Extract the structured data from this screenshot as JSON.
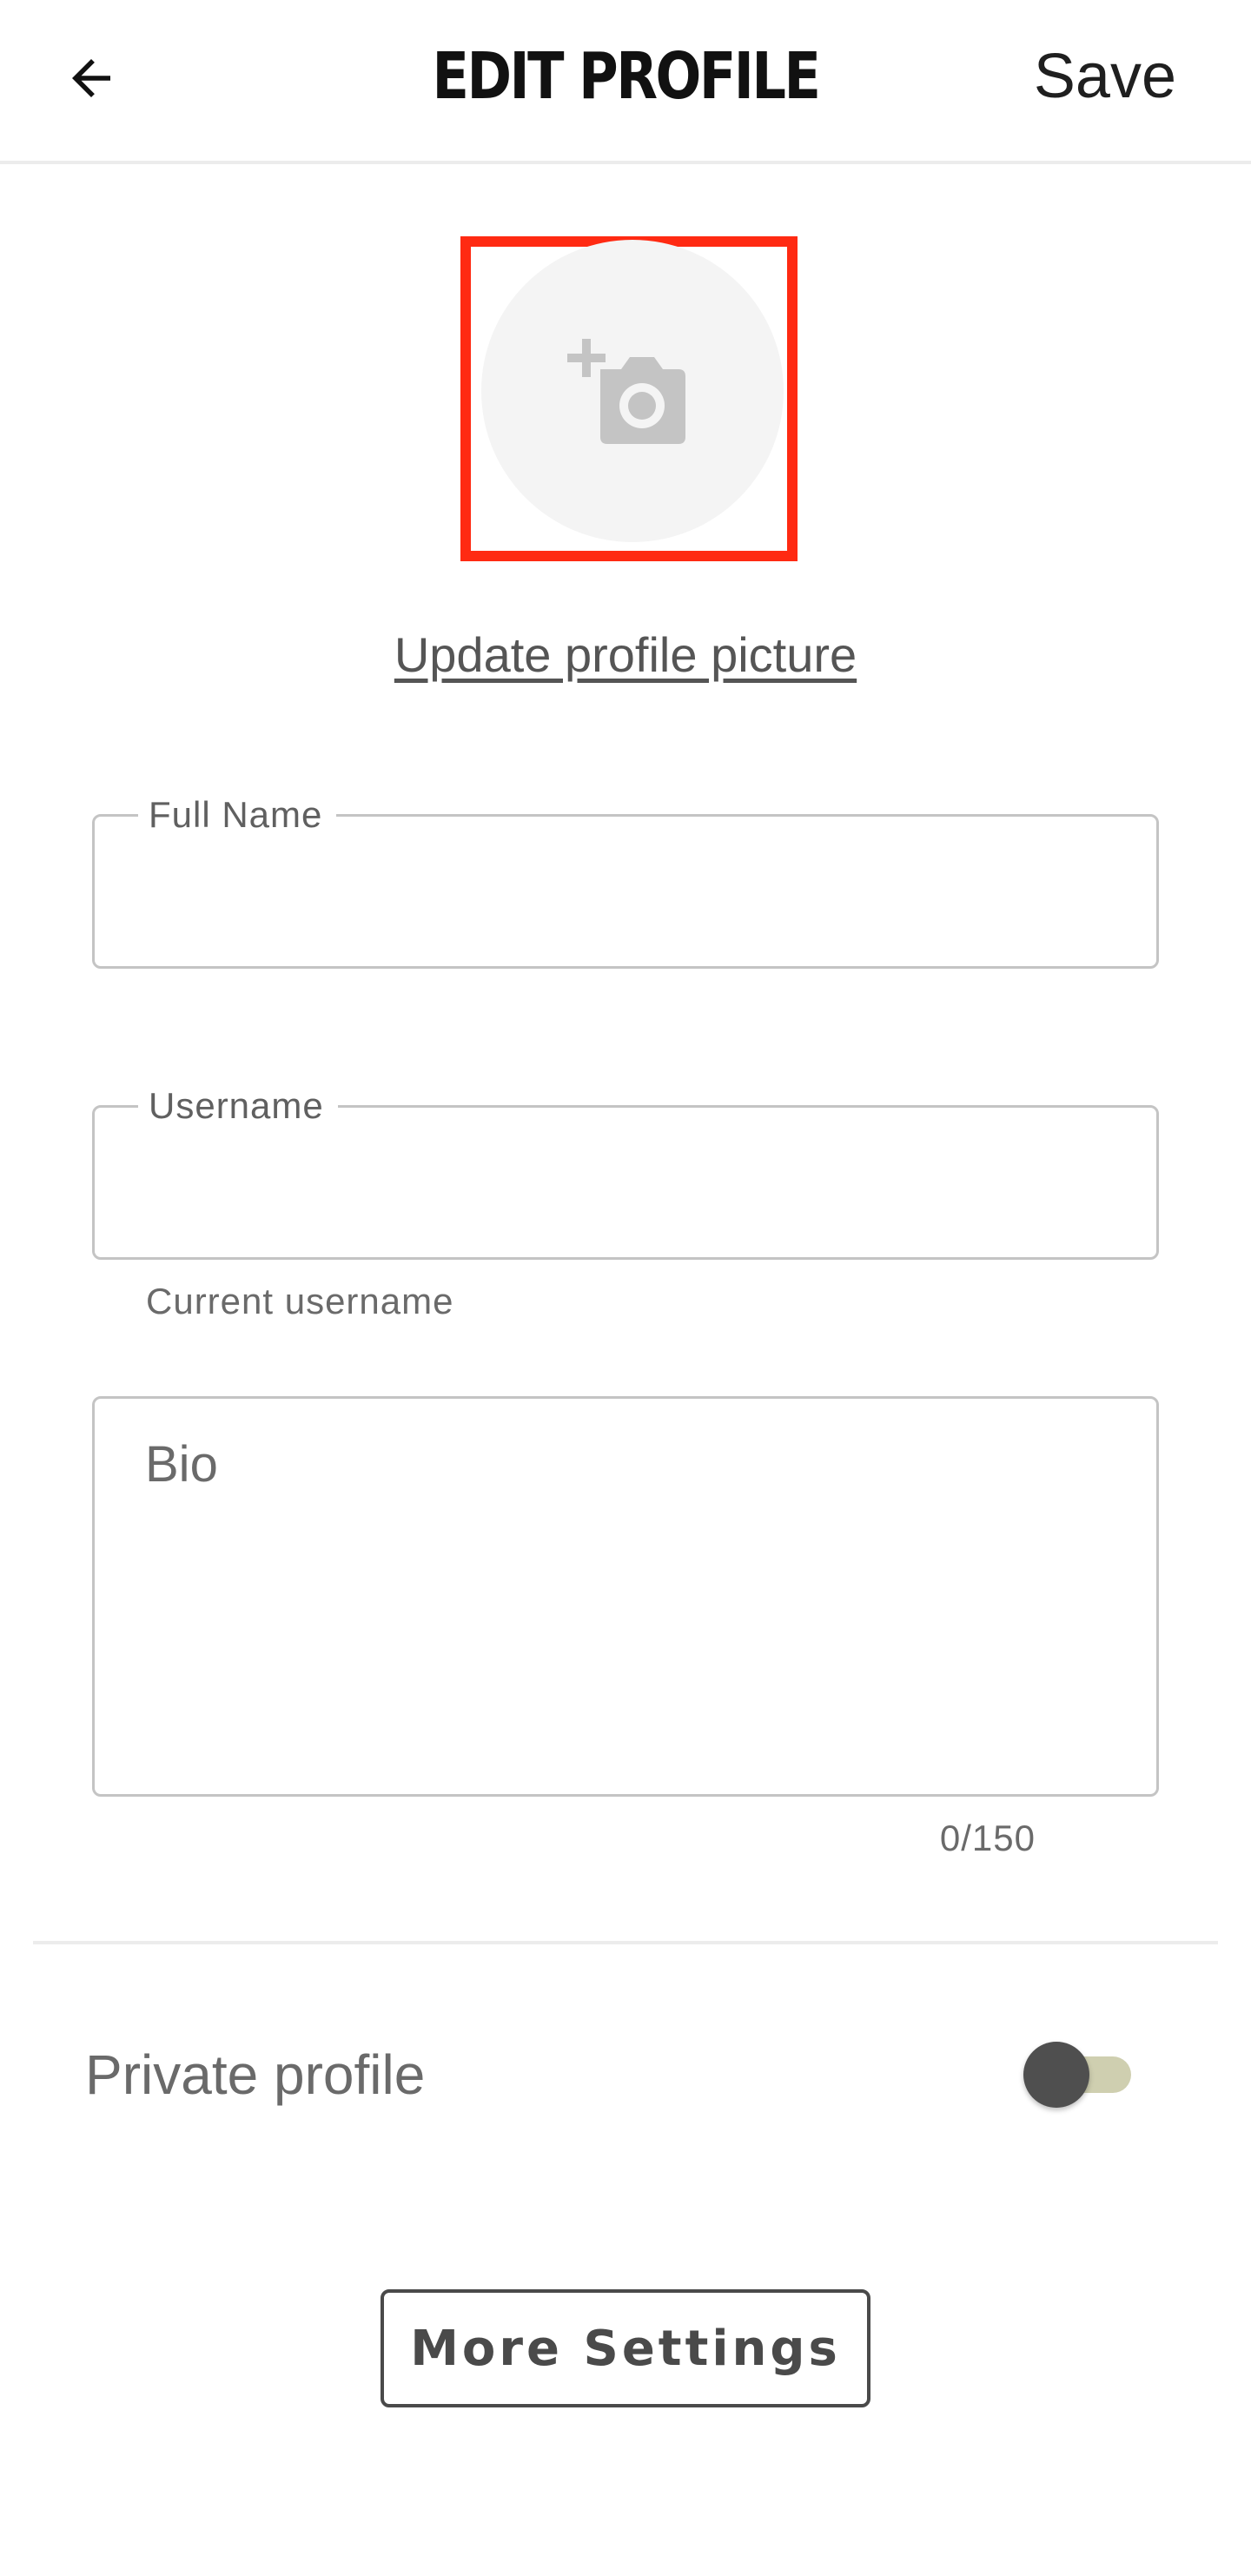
{
  "header": {
    "title": "EDIT PROFILE",
    "save_label": "Save",
    "back_icon": "arrow-left-icon"
  },
  "avatar": {
    "icon": "add-photo-camera-icon",
    "update_link": "Update profile picture",
    "highlight_color": "#ff2a12"
  },
  "form": {
    "full_name": {
      "label": "Full Name",
      "value": ""
    },
    "username": {
      "label": "Username",
      "value": "",
      "helper": "Current username"
    },
    "bio": {
      "placeholder": "Bio",
      "value": "",
      "counter": "0/150"
    }
  },
  "privacy": {
    "label": "Private profile",
    "enabled": false
  },
  "more_settings": {
    "label": "More Settings"
  }
}
